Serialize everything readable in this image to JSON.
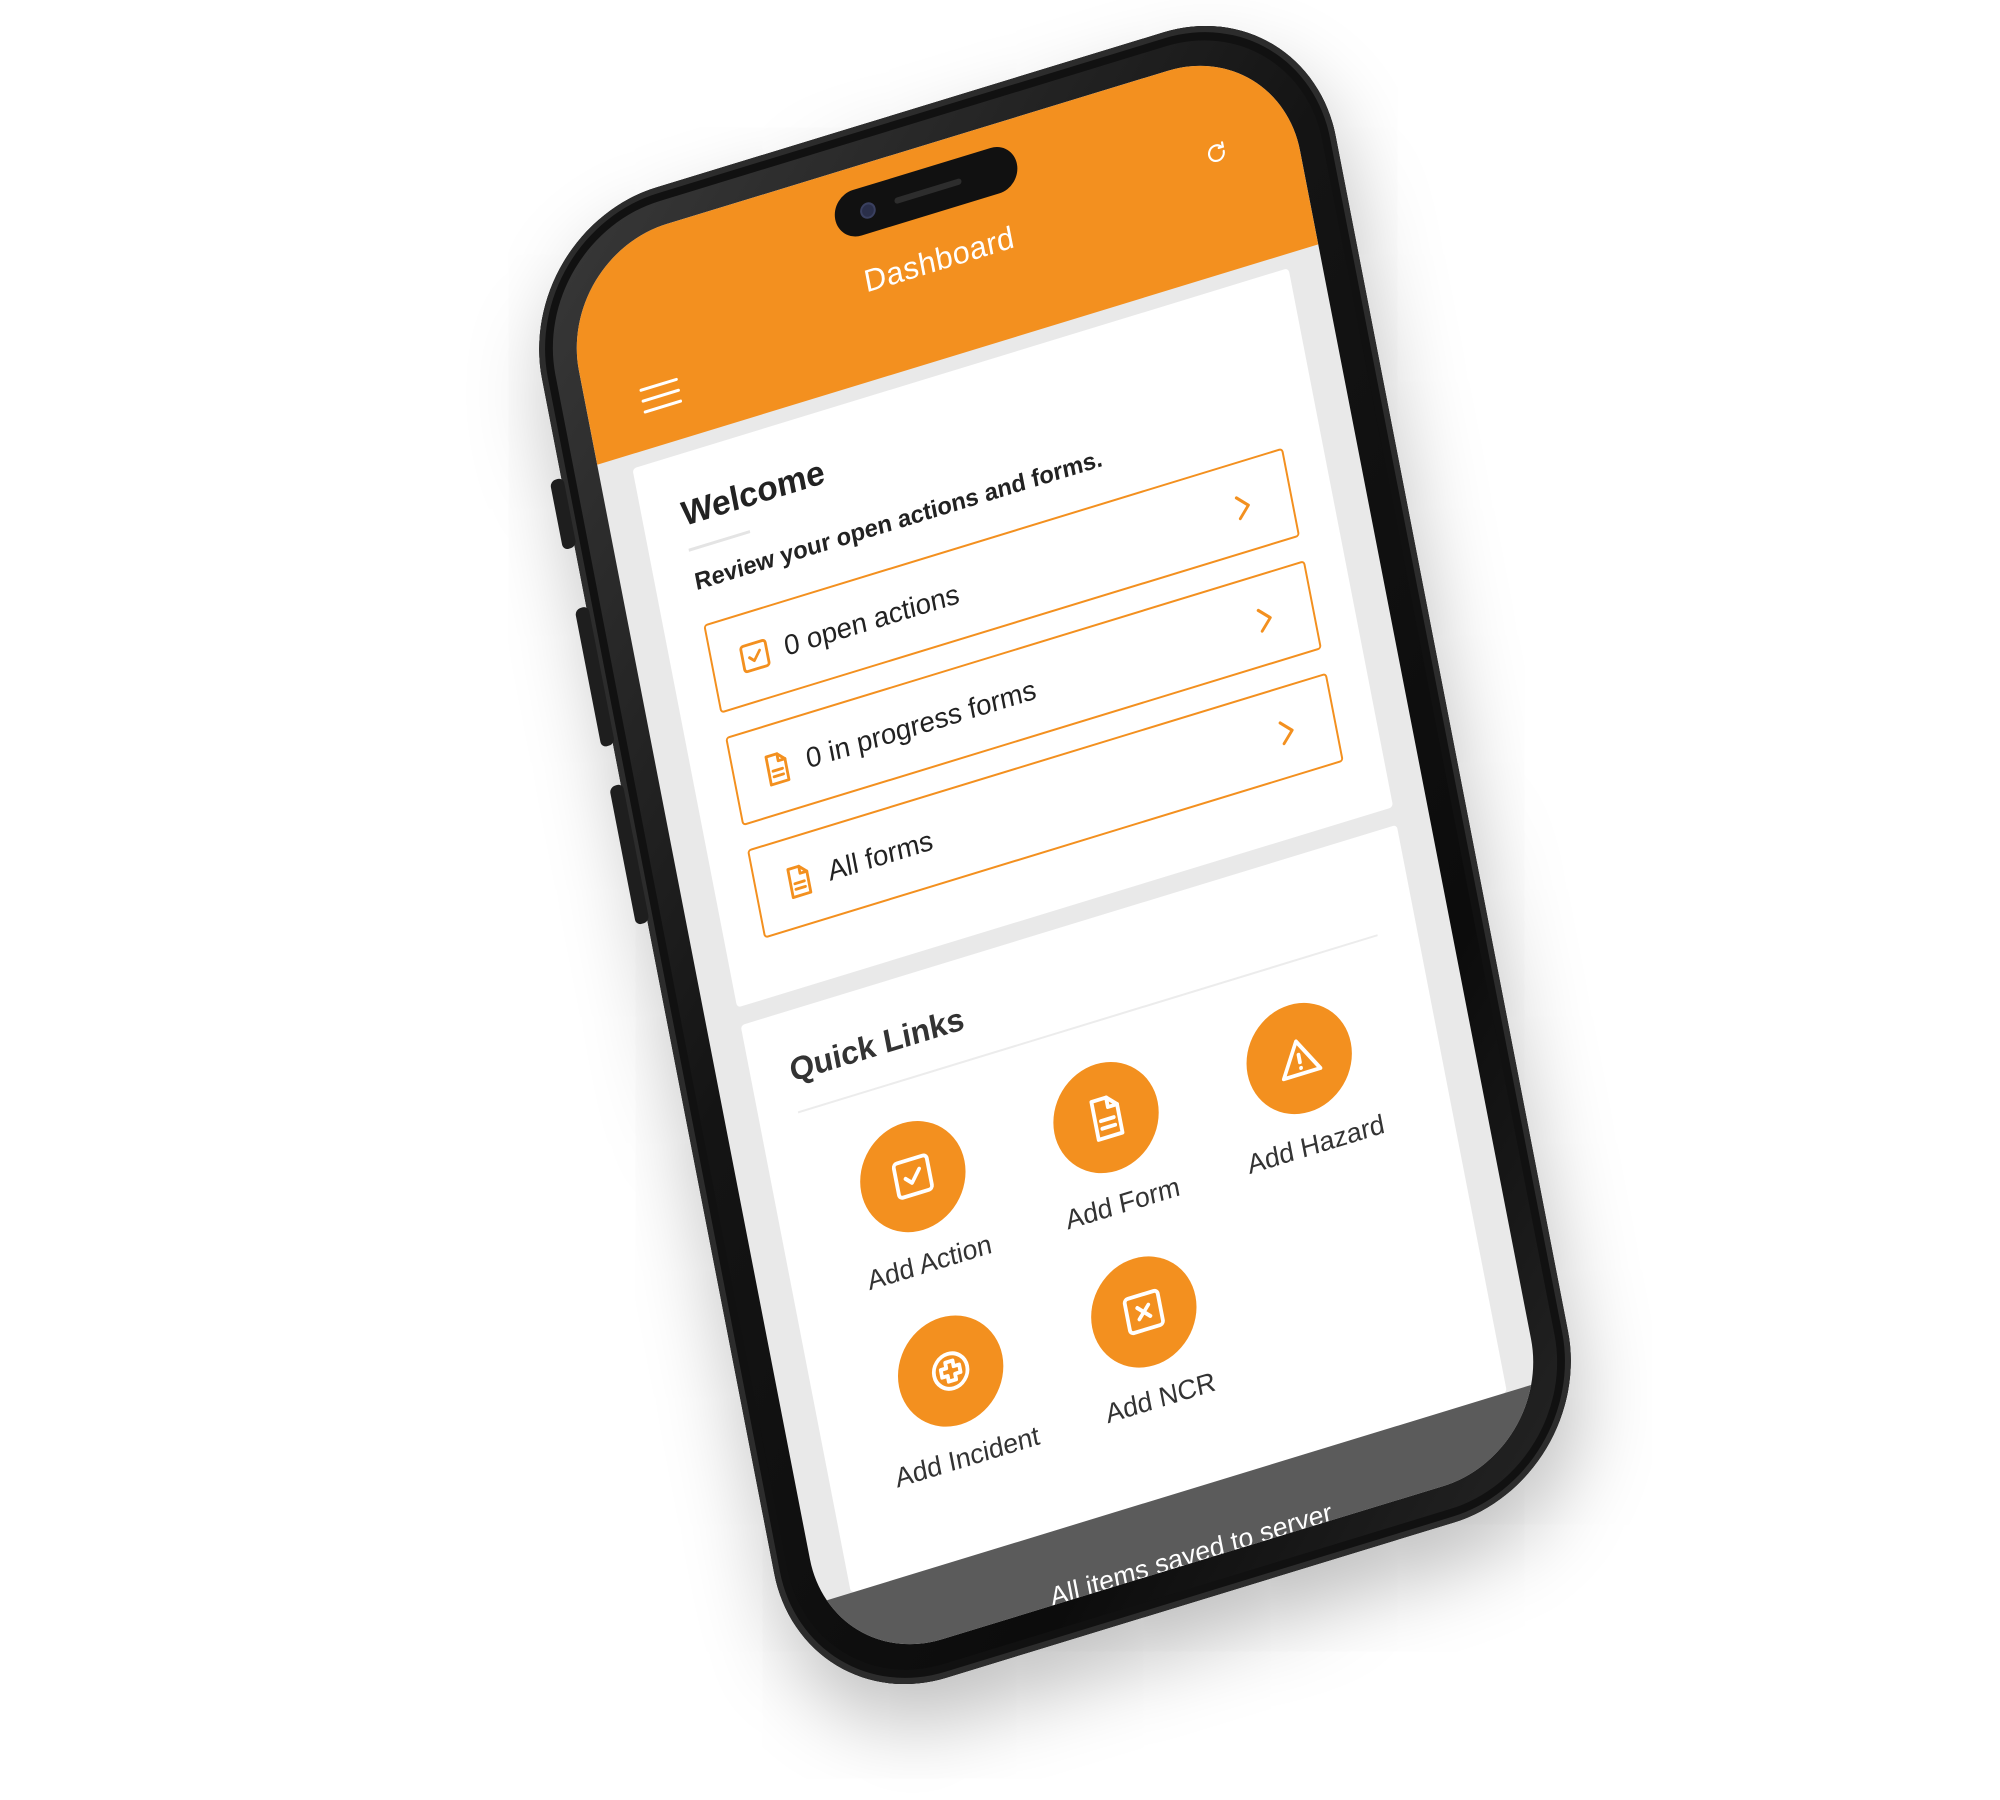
{
  "header": {
    "title": "Dashboard"
  },
  "welcome": {
    "title": "Welcome",
    "subtitle": "Review your open actions and forms."
  },
  "summary": [
    {
      "label": "0 open actions",
      "icon": "checkbox-icon"
    },
    {
      "label": "0 in progress forms",
      "icon": "document-icon"
    },
    {
      "label": "All forms",
      "icon": "document-icon"
    }
  ],
  "quick_links": {
    "title": "Quick Links",
    "items": [
      {
        "label": "Add Action",
        "icon": "checkbox-icon"
      },
      {
        "label": "Add Form",
        "icon": "document-icon"
      },
      {
        "label": "Add Hazard",
        "icon": "warning-icon"
      },
      {
        "label": "Add Incident",
        "icon": "medical-cross-icon"
      },
      {
        "label": "Add NCR",
        "icon": "x-box-icon"
      }
    ]
  },
  "status": {
    "text": "All items saved to server"
  },
  "colors": {
    "accent": "#f3901f",
    "status_bar": "#5b5b5b",
    "phone_body": "#141414"
  }
}
